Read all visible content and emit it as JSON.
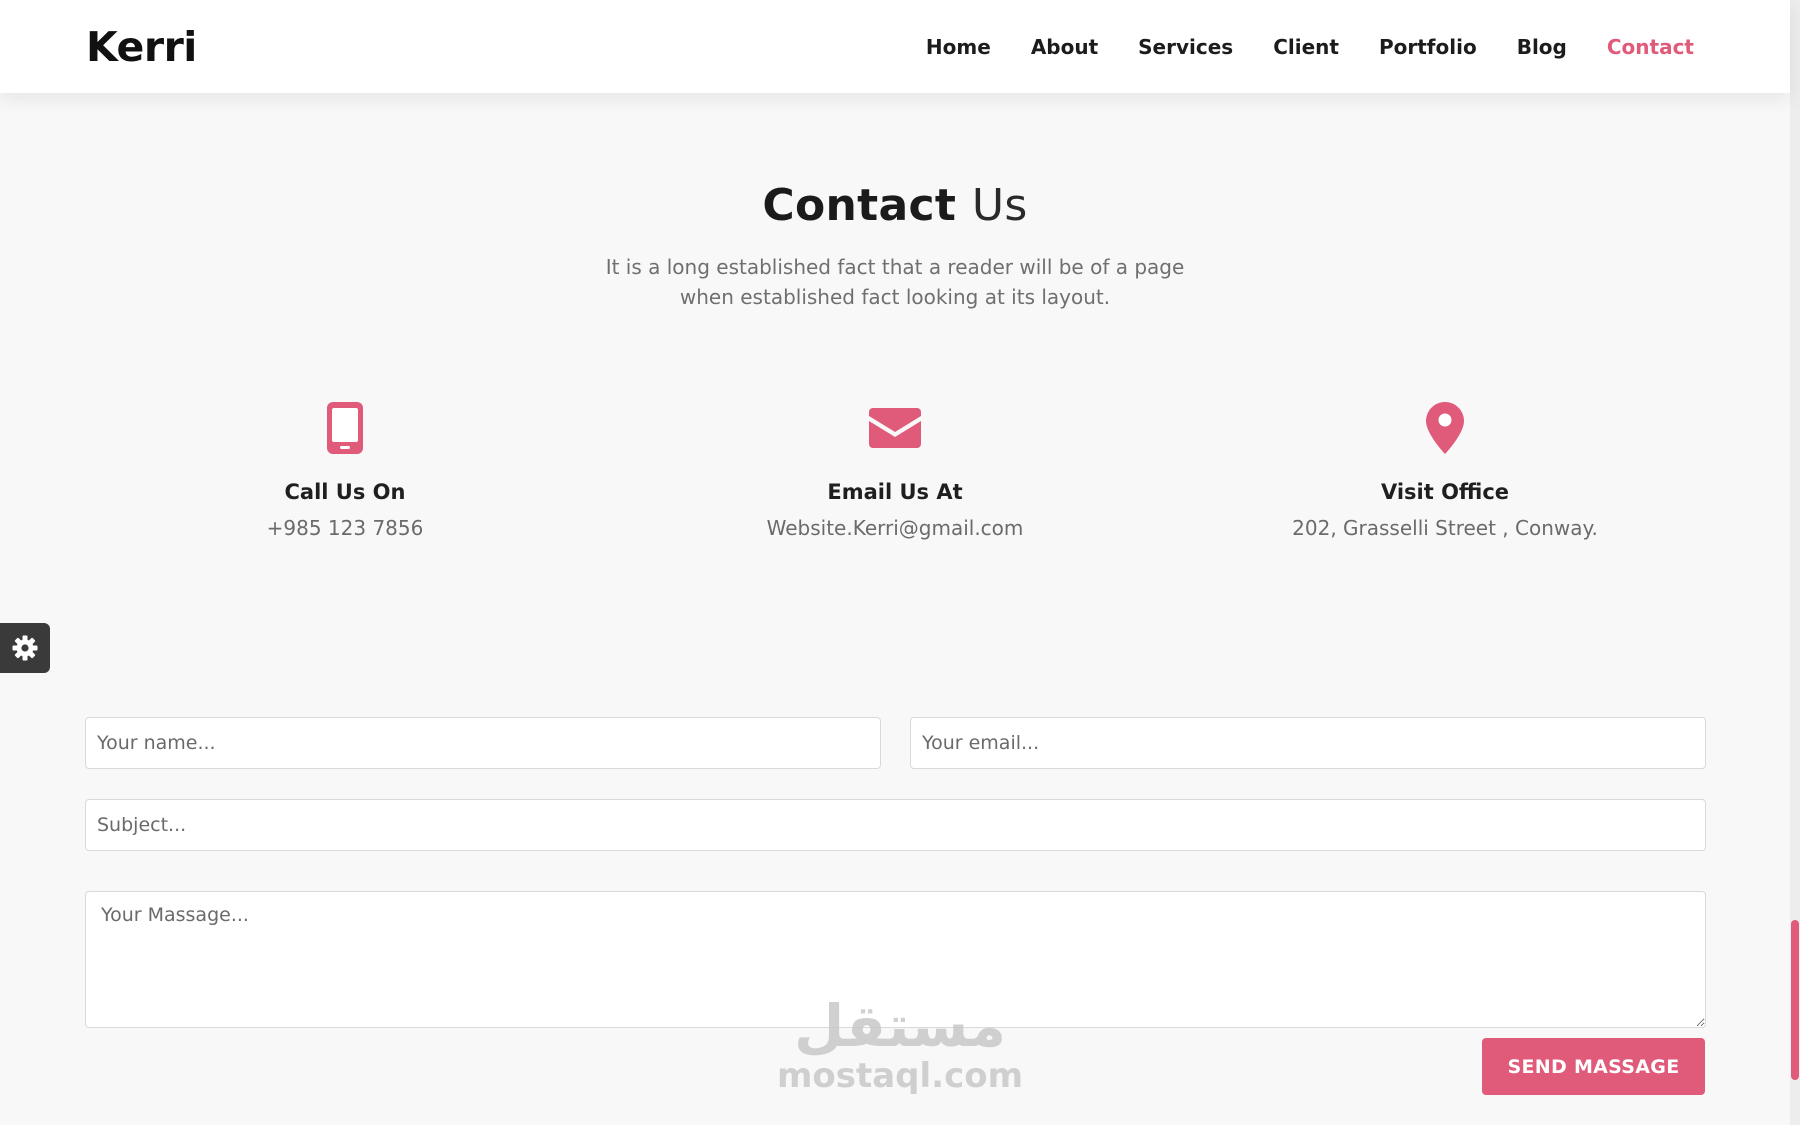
{
  "colors": {
    "accent": "#e05a7a"
  },
  "brand": "Kerri",
  "nav": {
    "items": [
      {
        "label": "Home",
        "active": false
      },
      {
        "label": "About",
        "active": false
      },
      {
        "label": "Services",
        "active": false
      },
      {
        "label": "Client",
        "active": false
      },
      {
        "label": "Portfolio",
        "active": false
      },
      {
        "label": "Blog",
        "active": false
      },
      {
        "label": "Contact",
        "active": true
      }
    ]
  },
  "section": {
    "title_bold": "Contact",
    "title_light": "Us",
    "intro": "It is a long established fact that a reader will be of a page when established fact looking at its layout."
  },
  "cards": [
    {
      "icon": "mobile-phone-icon",
      "title": "Call Us On",
      "value": "+985 123 7856"
    },
    {
      "icon": "envelope-icon",
      "title": "Email Us At",
      "value": "Website.Kerri@gmail.com"
    },
    {
      "icon": "map-marker-icon",
      "title": "Visit Office",
      "value": "202, Grasselli Street , Conway."
    }
  ],
  "settings": {
    "icon": "gear-icon"
  },
  "form": {
    "name_placeholder": "Your name...",
    "email_placeholder": "Your email...",
    "subject_placeholder": "Subject...",
    "message_placeholder": "Your Massage...",
    "submit_label": "SEND MASSAGE"
  },
  "watermark": {
    "arabic": "مستقل",
    "latin": "mostaql.com"
  }
}
